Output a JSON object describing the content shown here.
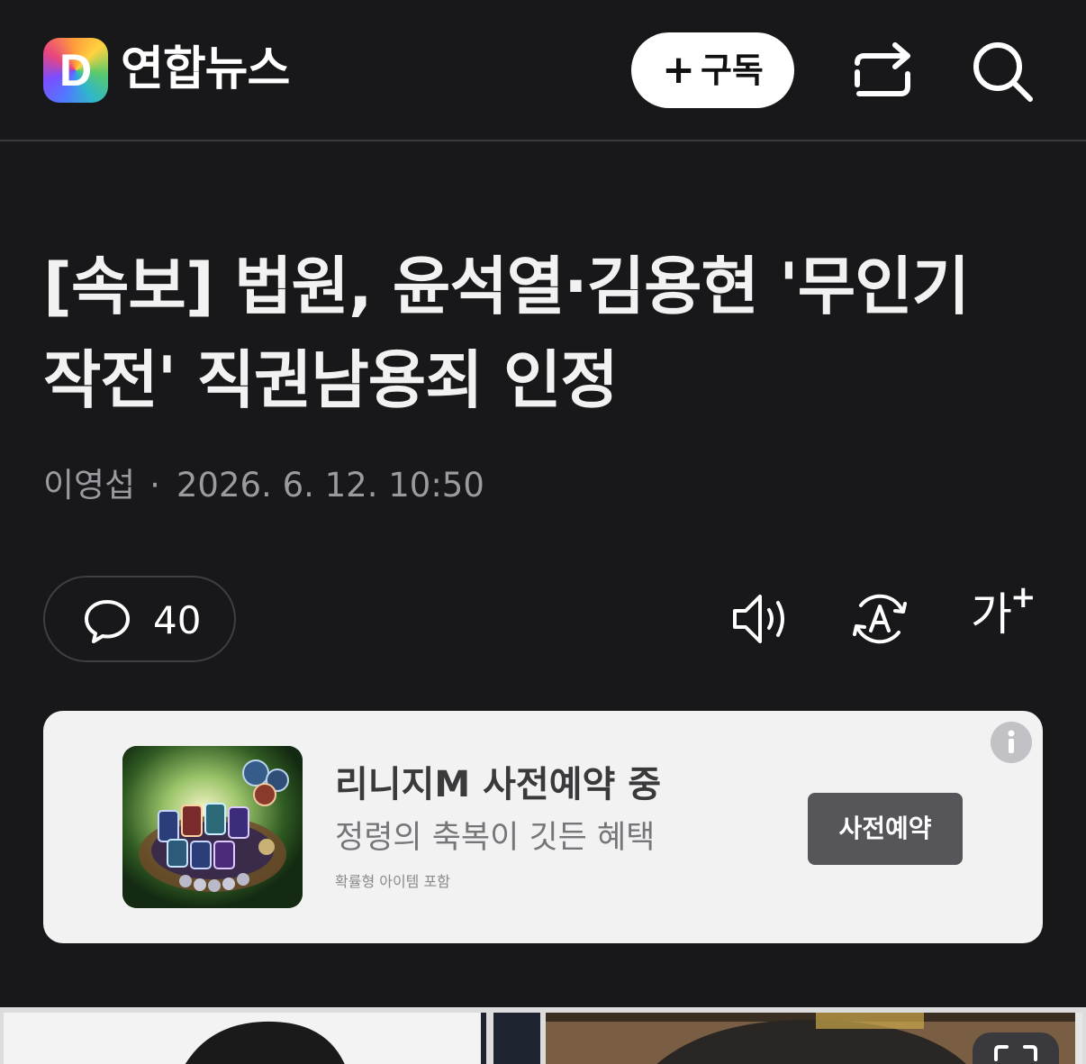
{
  "header": {
    "logo_letter": "D",
    "brand_name": "연합뉴스",
    "subscribe": {
      "plus": "+",
      "label": "구독"
    }
  },
  "article": {
    "headline_line1": "[속보] 법원, 윤석열·김용현 '무인기",
    "headline_line2": "작전' 직권남용죄 인정",
    "author": "이영섭",
    "separator": "·",
    "datetime": "2026. 6. 12. 10:50"
  },
  "toolbar": {
    "comment_count": "40",
    "font_size_label": "가",
    "font_size_plus": "+"
  },
  "ad": {
    "title": "리니지M 사전예약 중",
    "subtitle": "정령의 축복이 깃든 혜택",
    "note": "확률형 아이템 포함",
    "cta": "사전예약"
  },
  "colors": {
    "background": "#18181b",
    "ad_background": "#f2f2f3",
    "cta_background": "#56565a",
    "byline_text": "#9a9aa0"
  }
}
